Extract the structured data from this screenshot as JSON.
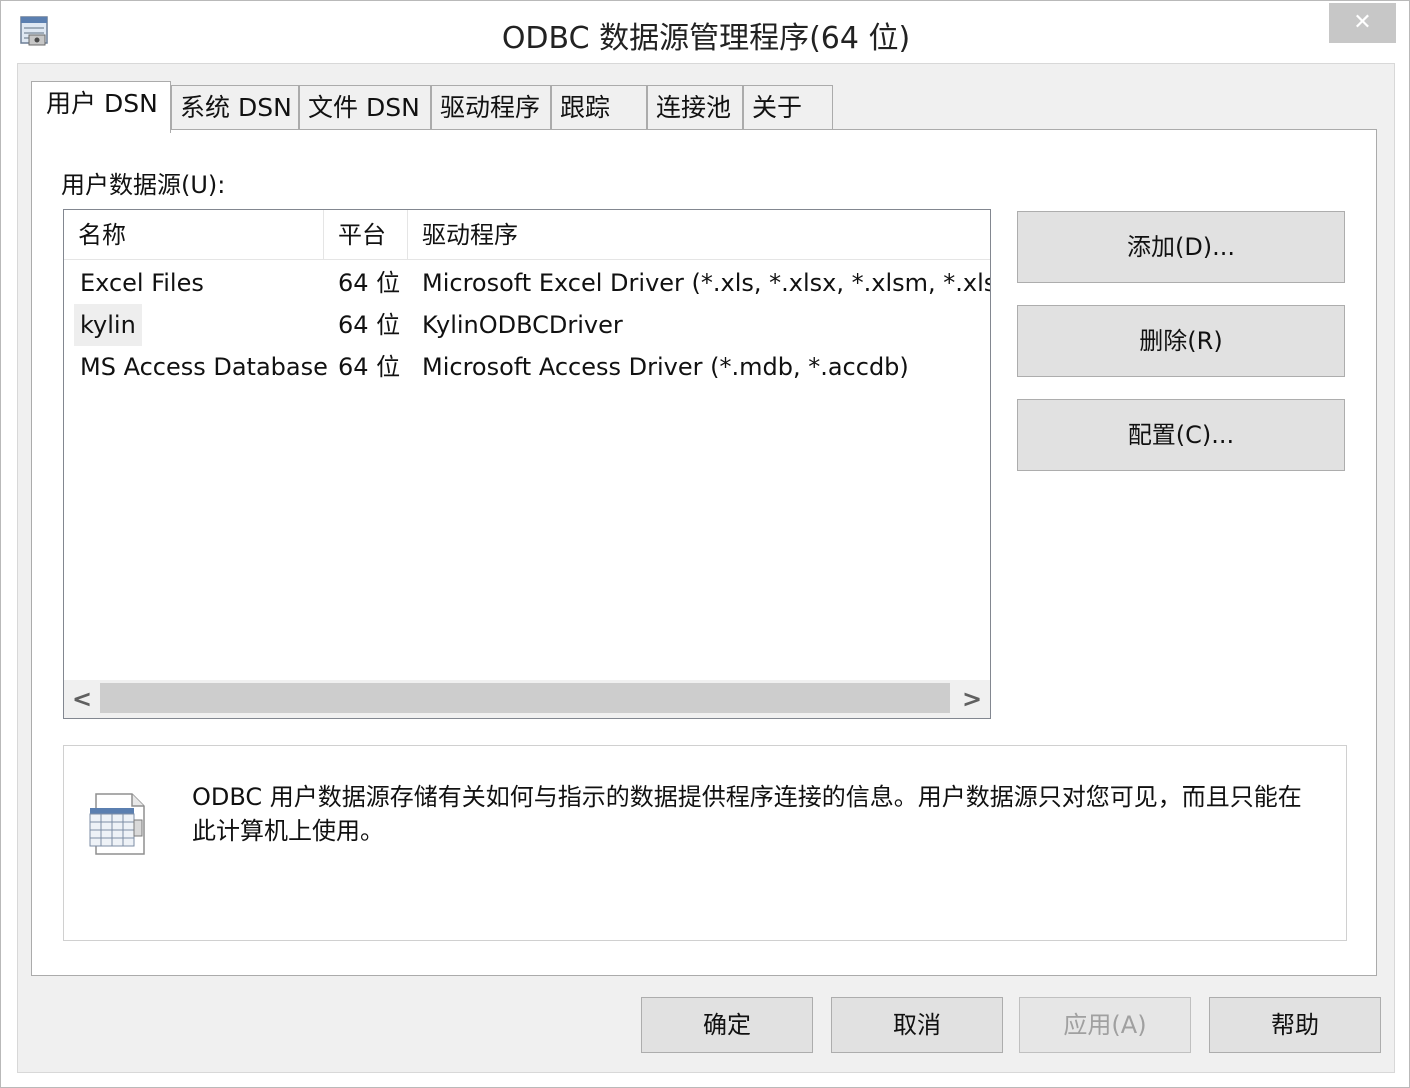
{
  "window": {
    "title": "ODBC 数据源管理程序(64 位)",
    "close_glyph": "✕"
  },
  "tabs": [
    {
      "label": "用户 DSN",
      "active": true
    },
    {
      "label": "系统 DSN"
    },
    {
      "label": "文件 DSN"
    },
    {
      "label": "驱动程序"
    },
    {
      "label": "跟踪"
    },
    {
      "label": "连接池"
    },
    {
      "label": "关于"
    }
  ],
  "panel": {
    "section_label": "用户数据源(U):",
    "columns": [
      "名称",
      "平台",
      "驱动程序"
    ],
    "rows": [
      {
        "name": "Excel Files",
        "platform": "64 位",
        "driver": "Microsoft Excel Driver (*.xls, *.xlsx, *.xlsm, *.xlsb)"
      },
      {
        "name": "kylin",
        "platform": "64 位",
        "driver": "KylinODBCDriver"
      },
      {
        "name": "MS Access Database",
        "platform": "64 位",
        "driver": "Microsoft Access Driver (*.mdb, *.accdb)"
      }
    ],
    "scroll_left": "<",
    "scroll_right": ">",
    "buttons": {
      "add": "添加(D)...",
      "remove": "删除(R)",
      "configure": "配置(C)..."
    },
    "info_text": "ODBC 用户数据源存储有关如何与指示的数据提供程序连接的信息。用户数据源只对您可见，而且只能在此计算机上使用。"
  },
  "footer": {
    "ok": "确定",
    "cancel": "取消",
    "apply": "应用(A)",
    "help": "帮助"
  },
  "icons": {
    "app": "odbc-admin-icon",
    "info": "datasource-document-icon"
  }
}
